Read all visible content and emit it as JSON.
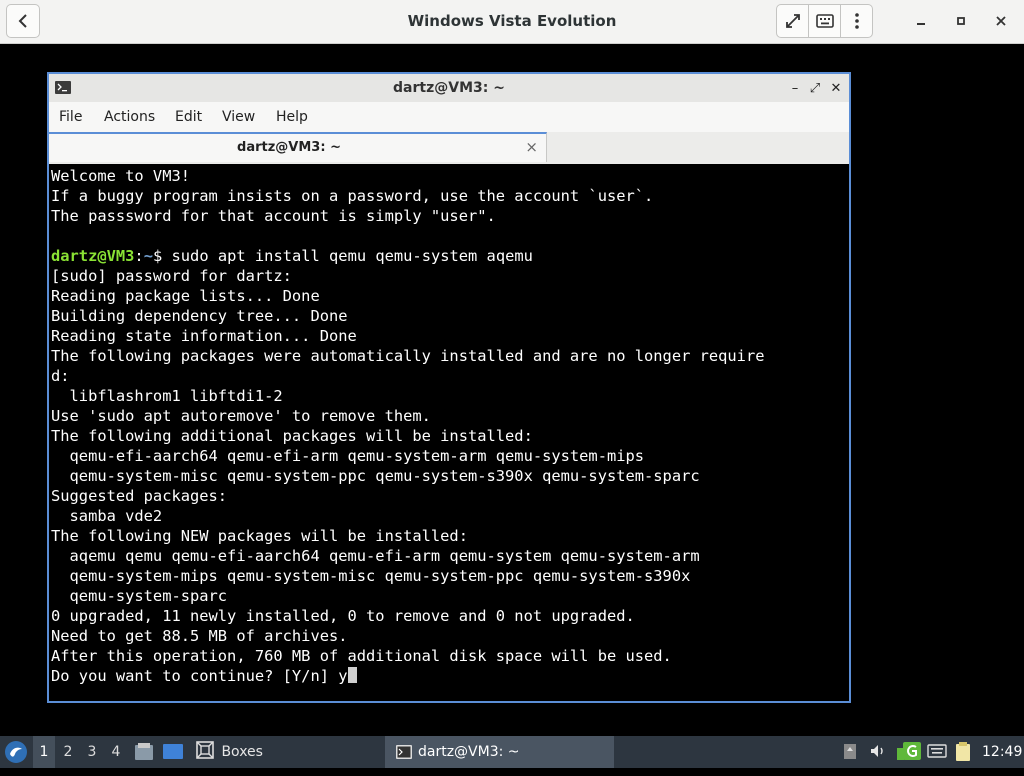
{
  "app": {
    "title": "Windows Vista Evolution"
  },
  "icons": {
    "back": "chevron-left-icon",
    "fullscreen": "fullscreen-icon",
    "keyboard": "keyboard-icon",
    "menu": "kebab-menu-icon",
    "minimize": "minimize-icon",
    "maximize": "maximize-icon",
    "close": "close-icon"
  },
  "terminal": {
    "title": "dartz@VM3: ~",
    "controls": {
      "minimize": "–",
      "maximize": "⤢",
      "close": "✕"
    },
    "menu": [
      "File",
      "Actions",
      "Edit",
      "View",
      "Help"
    ],
    "tab": {
      "label": "dartz@VM3: ~",
      "close": "×"
    },
    "prompt": {
      "user": "dartz@VM3",
      "sep": ":",
      "path": "~",
      "sym": "$",
      "command": " sudo apt install qemu qemu-system aqemu"
    },
    "lines_before": [
      "Welcome to VM3!",
      "If a buggy program insists on a password, use the account `user`.",
      "The passsword for that account is simply \"user\".",
      ""
    ],
    "lines_after": [
      "[sudo] password for dartz:",
      "Reading package lists... Done",
      "Building dependency tree... Done",
      "Reading state information... Done",
      "The following packages were automatically installed and are no longer require",
      "d:",
      "  libflashrom1 libftdi1-2",
      "Use 'sudo apt autoremove' to remove them.",
      "The following additional packages will be installed:",
      "  qemu-efi-aarch64 qemu-efi-arm qemu-system-arm qemu-system-mips",
      "  qemu-system-misc qemu-system-ppc qemu-system-s390x qemu-system-sparc",
      "Suggested packages:",
      "  samba vde2",
      "The following NEW packages will be installed:",
      "  aqemu qemu qemu-efi-aarch64 qemu-efi-arm qemu-system qemu-system-arm",
      "  qemu-system-mips qemu-system-misc qemu-system-ppc qemu-system-s390x",
      "  qemu-system-sparc",
      "0 upgraded, 11 newly installed, 0 to remove and 0 not upgraded.",
      "Need to get 88.5 MB of archives.",
      "After this operation, 760 MB of additional disk space will be used."
    ],
    "last_line": "Do you want to continue? [Y/n] y"
  },
  "taskbar": {
    "workspaces": [
      "1",
      "2",
      "3",
      "4"
    ],
    "active_workspace": "1",
    "boxes_label": "Boxes",
    "task_label": "dartz@VM3: ~",
    "clock": "12:49"
  }
}
